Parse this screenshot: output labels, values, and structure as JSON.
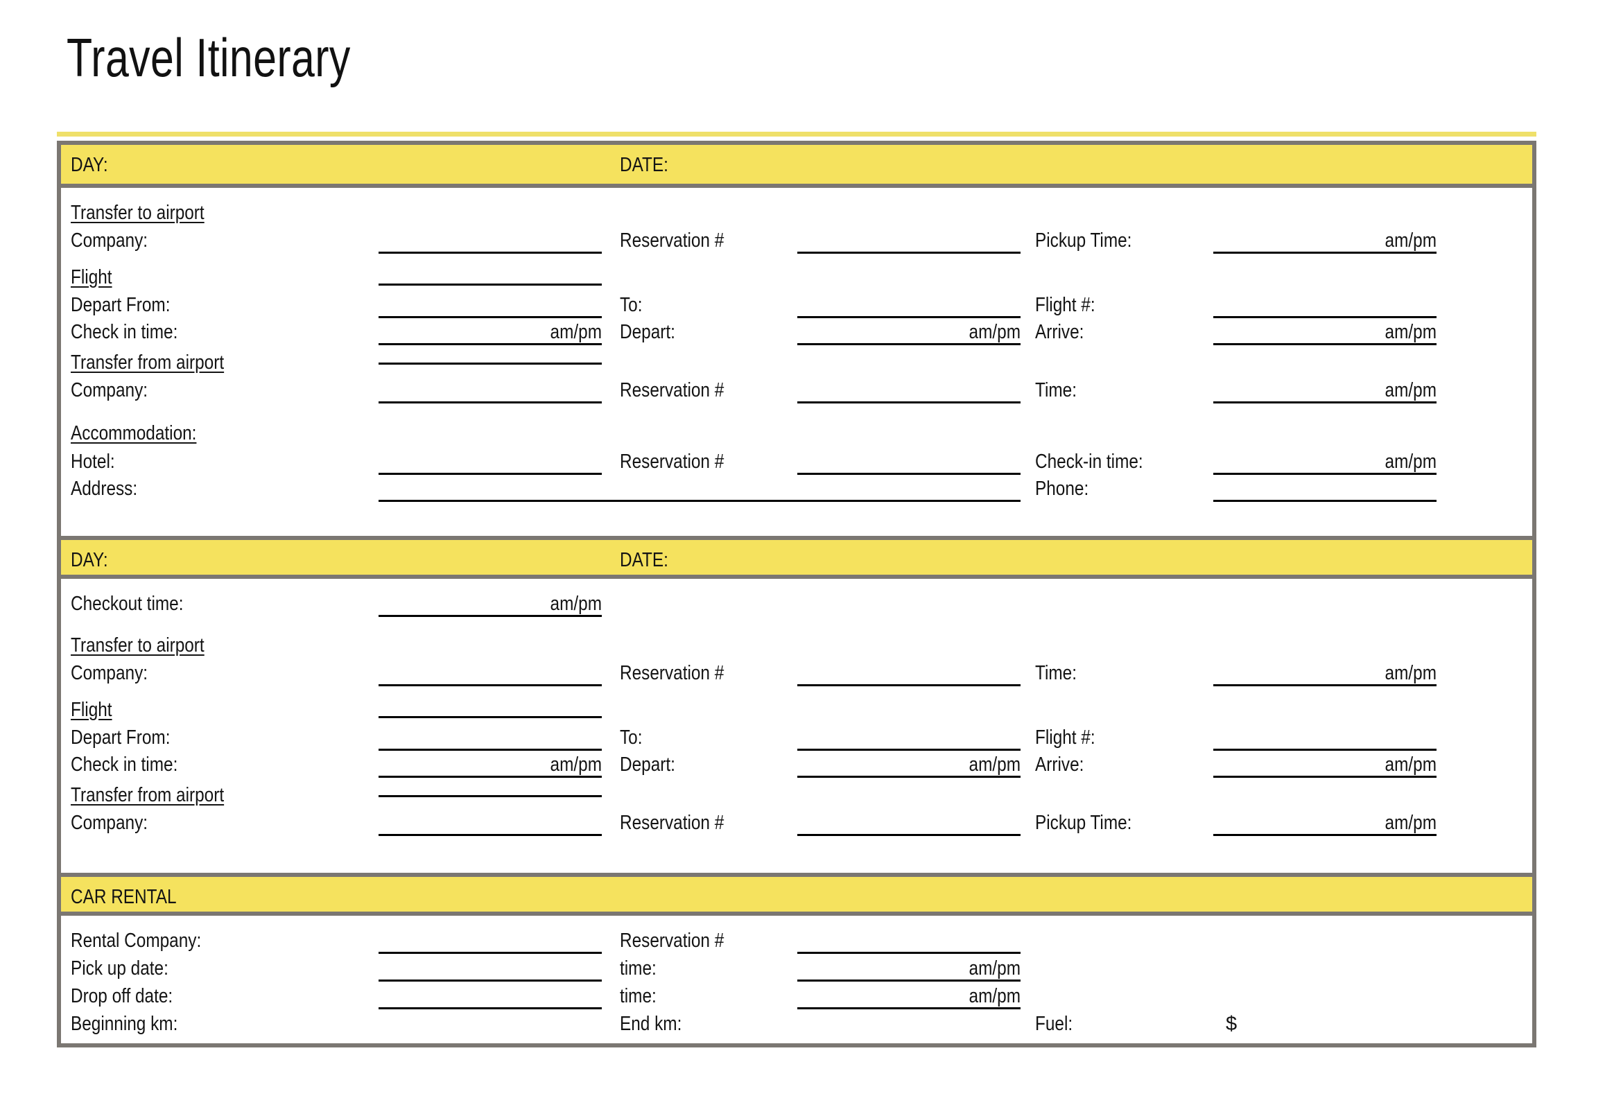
{
  "document": {
    "title": "Travel Itinerary"
  },
  "common": {
    "day_label": "DAY:",
    "date_label": "DATE:",
    "reservation_label": "Reservation #",
    "company_label": "Company:",
    "ampm": "am/pm",
    "depart_from_label": "Depart From:",
    "to_label": "To:",
    "flight_no_label": "Flight #:",
    "check_in_time_label": "Check in time:",
    "depart_label": "Depart:",
    "arrive_label": "Arrive:",
    "transfer_to_airport_label": "Transfer to airport",
    "transfer_from_airport_label": "Transfer from airport",
    "flight_section_label": "Flight",
    "time_label": "Time:",
    "pickup_time_label": "Pickup Time:"
  },
  "day1": {
    "day_label": "DAY:",
    "date_label": "DATE:",
    "transfer_to_airport": {
      "heading": "Transfer to airport",
      "company_label": "Company:",
      "reservation_label": "Reservation #",
      "pickup_time_label": "Pickup Time:",
      "pickup_ampm": "am/pm"
    },
    "flight": {
      "heading": "Flight",
      "depart_from_label": "Depart From:",
      "to_label": "To:",
      "flight_no_label": "Flight #:",
      "check_in_time_label": "Check in time:",
      "check_in_ampm": "am/pm",
      "depart_label": "Depart:",
      "depart_ampm": "am/pm",
      "arrive_label": "Arrive:",
      "arrive_ampm": "am/pm"
    },
    "transfer_from_airport": {
      "heading": "Transfer from airport",
      "company_label": "Company:",
      "reservation_label": "Reservation #",
      "time_label": "Time:",
      "time_ampm": "am/pm"
    },
    "accommodation": {
      "heading": "Accommodation:",
      "hotel_label": "Hotel:",
      "reservation_label": "Reservation #",
      "check_in_time_label": "Check-in time:",
      "check_in_ampm": "am/pm",
      "address_label": "Address:",
      "phone_label": "Phone:"
    }
  },
  "day2": {
    "day_label": "DAY:",
    "date_label": "DATE:",
    "checkout": {
      "label": "Checkout time:",
      "ampm": "am/pm"
    },
    "transfer_to_airport": {
      "heading": "Transfer to airport",
      "company_label": "Company:",
      "reservation_label": "Reservation #",
      "time_label": "Time:",
      "time_ampm": "am/pm"
    },
    "flight": {
      "heading": "Flight",
      "depart_from_label": "Depart From:",
      "to_label": "To:",
      "flight_no_label": "Flight #:",
      "check_in_time_label": "Check in time:",
      "check_in_ampm": "am/pm",
      "depart_label": "Depart:",
      "depart_ampm": "am/pm",
      "arrive_label": "Arrive:",
      "arrive_ampm": "am/pm"
    },
    "transfer_from_airport": {
      "heading": "Transfer from airport",
      "company_label": "Company:",
      "reservation_label": "Reservation #",
      "pickup_time_label": "Pickup Time:",
      "pickup_ampm": "am/pm"
    }
  },
  "car_rental": {
    "heading": "CAR RENTAL",
    "rental_company_label": "Rental Company:",
    "reservation_label": "Reservation #",
    "pick_up_date_label": "Pick up date:",
    "pick_up_time_label": "time:",
    "pick_up_ampm": "am/pm",
    "drop_off_date_label": "Drop off date:",
    "drop_off_time_label": "time:",
    "drop_off_ampm": "am/pm",
    "beginning_km_label": "Beginning km:",
    "end_km_label": "End km:",
    "fuel_label": "Fuel:",
    "fuel_currency": "$"
  },
  "colors": {
    "band_yellow": "#f5e25e",
    "rule_yellow": "#efe06a",
    "border_gray": "#7b7772",
    "text": "#141414"
  }
}
